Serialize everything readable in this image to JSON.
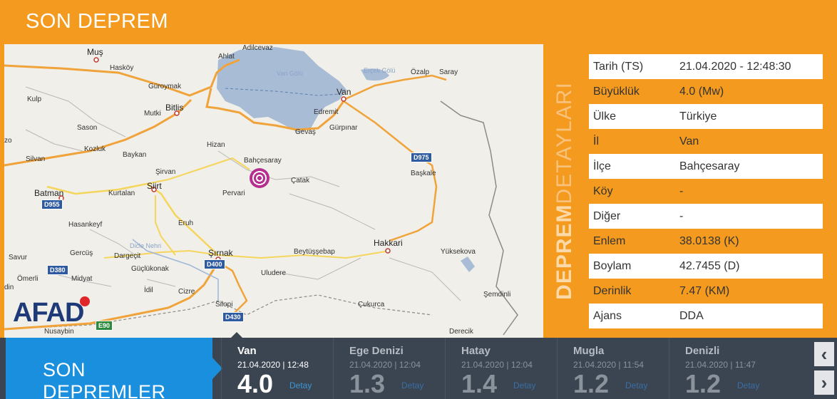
{
  "header": {
    "title": "SON DEPREM"
  },
  "map": {
    "labels": {
      "mus": "Muş",
      "ahlat": "Ahlat",
      "adilcevaz": "Adilcevaz",
      "hasköy": "Hasköy",
      "kulp": "Kulp",
      "guroymak": "Güroymak",
      "bitlis": "Bitlis",
      "mutki": "Mutki",
      "sason": "Sason",
      "zo": "zo",
      "silvan": "Silvan",
      "kozluk": "Kozluk",
      "baykan": "Baykan",
      "hizan": "Hizan",
      "bahcesaray": "Bahçesaray",
      "sirvan": "Şirvan",
      "batman": "Batman",
      "kurtalan": "Kurtalan",
      "siirt": "Siirt",
      "pervari": "Pervari",
      "catak": "Çatak",
      "hasankeyf": "Hasankeyf",
      "eruh": "Eruh",
      "gercus": "Gercüş",
      "dargecit": "Dargeçit",
      "savur": "Savur",
      "sirnak": "Şırnak",
      "beytussebap": "Beytüşşebap",
      "hakkari": "Hakkari",
      "yuksekova": "Yüksekova",
      "omerli": "Ömerli",
      "midyat": "Midyat",
      "guclukonak": "Güçlükonak",
      "uludere": "Uludere",
      "idil": "İdil",
      "cizre": "Cizre",
      "silopi": "Silopi",
      "cukurca": "Çukurca",
      "semdinli": "Şemdinli",
      "nusaybin": "Nusaybin",
      "derecik": "Derecik",
      "van": "Van",
      "edremit": "Edremit",
      "gevas": "Gevaş",
      "gurpinar": "Gürpınar",
      "ozalp": "Özalp",
      "saray": "Saray",
      "baskale": "Başkale",
      "ercis_golu": "Erçek Gölü",
      "van_golu": "Van Gölü",
      "dicle": "Dicle Nehri",
      "din": "din"
    },
    "roads": {
      "d955": "D955",
      "d975": "D975",
      "d380": "D380",
      "d400": "D400",
      "d430": "D430",
      "e90": "E90"
    },
    "logo": "AFAD"
  },
  "details_title": {
    "bold": "DEPREM",
    "light": "DETAYLARI"
  },
  "details": [
    {
      "key": "Tarih (TS)",
      "value": "21.04.2020 - 12:48:30"
    },
    {
      "key": "Büyüklük",
      "value": "4.0 (Mw)"
    },
    {
      "key": "Ülke",
      "value": "Türkiye"
    },
    {
      "key": "İl",
      "value": "Van"
    },
    {
      "key": "İlçe",
      "value": "Bahçesaray"
    },
    {
      "key": "Köy",
      "value": "-"
    },
    {
      "key": "Diğer",
      "value": "-"
    },
    {
      "key": "Enlem",
      "value": "38.0138 (K)"
    },
    {
      "key": "Boylam",
      "value": "42.7455 (D)"
    },
    {
      "key": "Derinlik",
      "value": "7.47 (KM)"
    },
    {
      "key": "Ajans",
      "value": "DDA"
    }
  ],
  "recent": {
    "title": "SON DEPREMLER",
    "items": [
      {
        "location": "Van",
        "time": "21.04.2020 | 12:48",
        "magnitude": "4.0",
        "detail": "Detay"
      },
      {
        "location": "Ege Denizi",
        "time": "21.04.2020 | 12:04",
        "magnitude": "1.3",
        "detail": "Detay"
      },
      {
        "location": "Hatay",
        "time": "21.04.2020 | 12:04",
        "magnitude": "1.4",
        "detail": "Detay"
      },
      {
        "location": "Mugla",
        "time": "21.04.2020 | 11:54",
        "magnitude": "1.2",
        "detail": "Detay"
      },
      {
        "location": "Denizli",
        "time": "21.04.2020 | 11:47",
        "magnitude": "1.2",
        "detail": "Detay"
      }
    ],
    "prev_icon": "chevron-left-icon",
    "next_icon": "chevron-right-icon"
  }
}
